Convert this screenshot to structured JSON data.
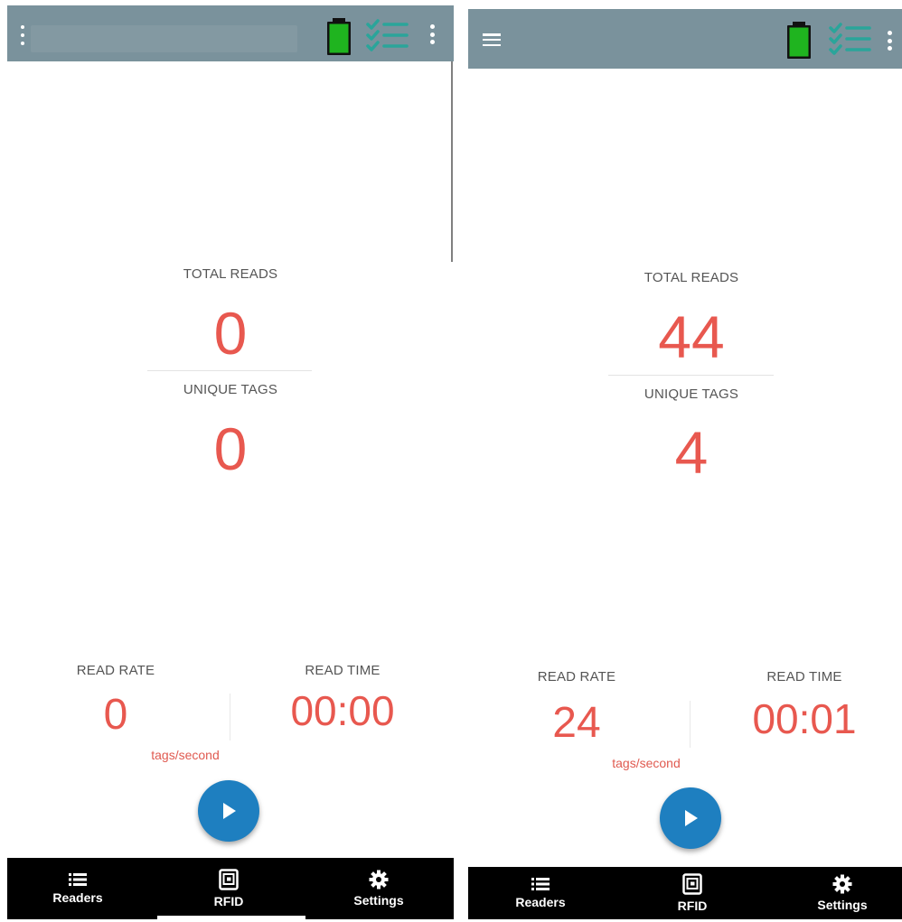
{
  "colors": {
    "appbar": "#7a929c",
    "value_red": "#e8584f",
    "fab_blue": "#1e7fc0",
    "battery_green": "#1fb41f",
    "checklist_teal": "#2aa59a",
    "nav_bg": "#000000"
  },
  "icons": {
    "battery": "battery-full-icon",
    "checklist": "checklist-icon",
    "menu": "hamburger-menu-icon",
    "overflow": "more-vert-icon",
    "play": "play-icon",
    "readers": "list-icon",
    "rfid": "rfid-chip-icon",
    "settings": "gear-icon"
  },
  "screens": [
    {
      "stats": {
        "total_reads_label": "TOTAL READS",
        "total_reads": "0",
        "unique_tags_label": "UNIQUE TAGS",
        "unique_tags": "0"
      },
      "rate": {
        "read_rate_label": "READ RATE",
        "read_rate": "0",
        "read_time_label": "READ TIME",
        "read_time": "00:00",
        "unit": "tags/second"
      },
      "nav": {
        "readers": "Readers",
        "rfid": "RFID",
        "settings": "Settings",
        "active": "RFID"
      }
    },
    {
      "stats": {
        "total_reads_label": "TOTAL READS",
        "total_reads": "44",
        "unique_tags_label": "UNIQUE TAGS",
        "unique_tags": "4"
      },
      "rate": {
        "read_rate_label": "READ RATE",
        "read_rate": "24",
        "read_time_label": "READ TIME",
        "read_time": "00:01",
        "unit": "tags/second"
      },
      "nav": {
        "readers": "Readers",
        "rfid": "RFID",
        "settings": "Settings",
        "active": "RFID"
      }
    }
  ]
}
